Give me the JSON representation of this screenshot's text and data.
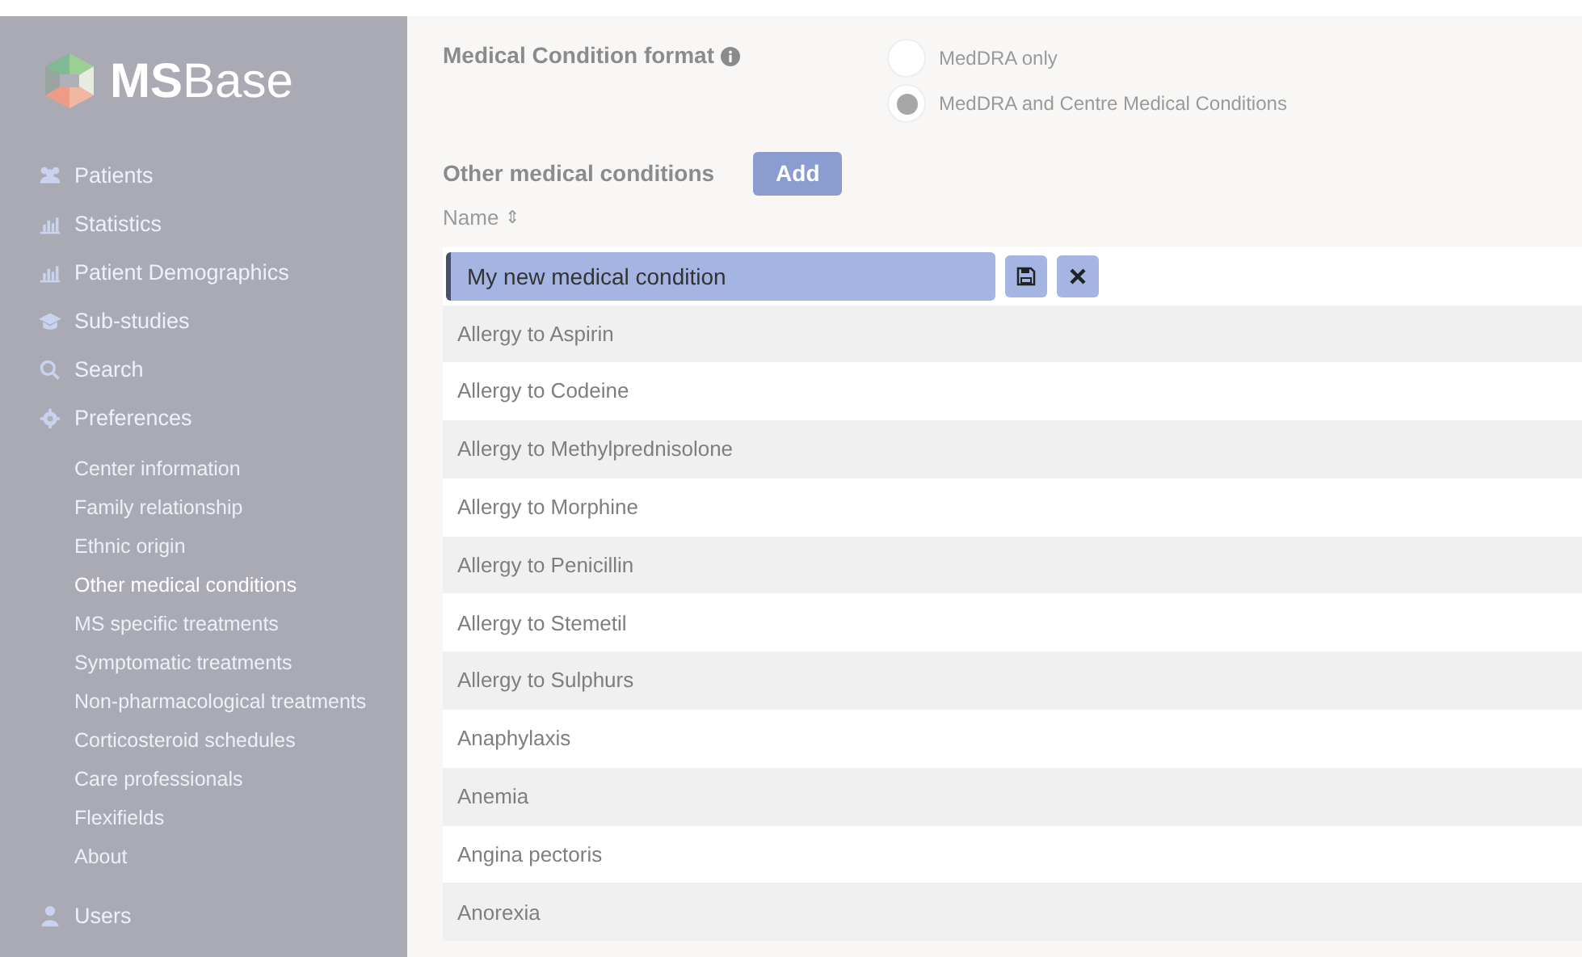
{
  "sidebar": {
    "logo": {
      "bold": "MS",
      "rest": "Base"
    },
    "items": [
      {
        "label": "Patients"
      },
      {
        "label": "Statistics"
      },
      {
        "label": "Patient Demographics"
      },
      {
        "label": "Sub-studies"
      },
      {
        "label": "Search"
      },
      {
        "label": "Preferences",
        "children": [
          {
            "label": "Center information",
            "selected": false
          },
          {
            "label": "Family relationship",
            "selected": false
          },
          {
            "label": "Ethnic origin",
            "selected": false
          },
          {
            "label": "Other medical conditions",
            "selected": true
          },
          {
            "label": "MS specific treatments",
            "selected": false
          },
          {
            "label": "Symptomatic treatments",
            "selected": false
          },
          {
            "label": "Non-pharmacological treatments",
            "selected": false
          },
          {
            "label": "Corticosteroid schedules",
            "selected": false
          },
          {
            "label": "Care professionals",
            "selected": false
          },
          {
            "label": "Flexifields",
            "selected": false
          },
          {
            "label": "About",
            "selected": false
          }
        ]
      },
      {
        "label": "Users"
      }
    ]
  },
  "format": {
    "label": "Medical Condition format",
    "options": [
      {
        "label": "MedDRA only",
        "selected": false
      },
      {
        "label": "MedDRA and Centre Medical Conditions",
        "selected": true
      }
    ]
  },
  "conditions": {
    "title": "Other medical conditions",
    "add_button": "Add",
    "column": "Name",
    "sort_icon": "⇕",
    "editor": {
      "value": "My new medical condition"
    },
    "rows": [
      "Allergy to Aspirin",
      "Allergy to Codeine",
      "Allergy to Methylprednisolone",
      "Allergy to Morphine",
      "Allergy to Penicillin",
      "Allergy to Stemetil",
      "Allergy to Sulphurs",
      "Anaphylaxis",
      "Anemia",
      "Angina pectoris",
      "Anorexia"
    ]
  }
}
